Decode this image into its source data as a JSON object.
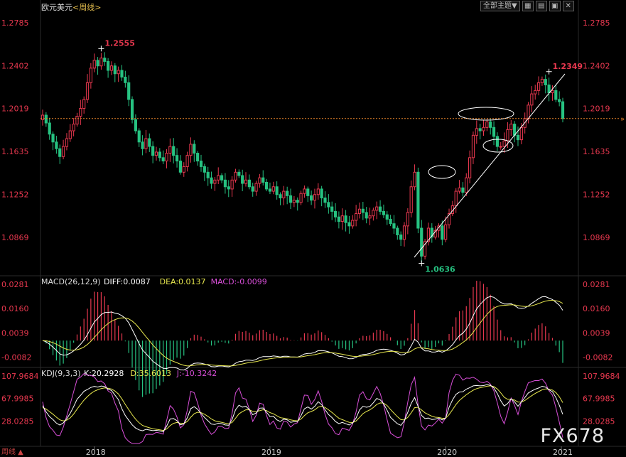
{
  "header": {
    "symbol": "欧元美元",
    "period": "<周线>",
    "menu_label": "全部主题▼",
    "icons": [
      "grid-icon",
      "list-icon",
      "restore-icon",
      "close-icon"
    ]
  },
  "watermark": "FX678",
  "footer_label": "周线 ▲",
  "colors": {
    "up": "#e8384f",
    "down": "#26c281",
    "price_axis": "#e8384f",
    "macd_diff": "#ffffff",
    "macd_dea": "#e8e84f",
    "macd_bar": "#e8384f",
    "kdj_k": "#ffffff",
    "kdj_d": "#e8e84f",
    "kdj_j": "#d94fd9",
    "ref_line": "#e8842a"
  },
  "chart_data": [
    {
      "type": "candlestick",
      "price_axis_ticks": [
        "1.2785",
        "1.2402",
        "1.2019",
        "1.1635",
        "1.1252",
        "1.0869"
      ],
      "ylim": [
        1.055,
        1.29
      ],
      "x_labels": [
        "2018",
        "2019",
        "2020",
        "2021"
      ],
      "annotations": [
        {
          "text": "1.2555",
          "value": 1.2555,
          "date": "2018-02"
        },
        {
          "text": "1.2349",
          "value": 1.2349,
          "date": "2021-01"
        },
        {
          "text": "1.0636",
          "value": 1.0636,
          "date": "2020-03"
        }
      ],
      "current_price": 1.193,
      "weekly_close": [
        1.196,
        1.189,
        1.179,
        1.172,
        1.166,
        1.159,
        1.168,
        1.175,
        1.182,
        1.188,
        1.195,
        1.202,
        1.21,
        1.225,
        1.238,
        1.245,
        1.24,
        1.247,
        1.244,
        1.236,
        1.24,
        1.233,
        1.236,
        1.23,
        1.225,
        1.21,
        1.192,
        1.182,
        1.172,
        1.166,
        1.175,
        1.168,
        1.16,
        1.163,
        1.158,
        1.155,
        1.162,
        1.168,
        1.16,
        1.155,
        1.145,
        1.15,
        1.16,
        1.17,
        1.162,
        1.155,
        1.15,
        1.145,
        1.14,
        1.135,
        1.138,
        1.142,
        1.138,
        1.132,
        1.13,
        1.138,
        1.145,
        1.142,
        1.135,
        1.138,
        1.132,
        1.128,
        1.135,
        1.14,
        1.136,
        1.13,
        1.128,
        1.132,
        1.125,
        1.122,
        1.128,
        1.124,
        1.118,
        1.12,
        1.118,
        1.126,
        1.13,
        1.124,
        1.12,
        1.125,
        1.13,
        1.122,
        1.118,
        1.114,
        1.11,
        1.105,
        1.101,
        1.106,
        1.1,
        1.097,
        1.102,
        1.108,
        1.112,
        1.109,
        1.104,
        1.106,
        1.111,
        1.114,
        1.11,
        1.107,
        1.103,
        1.099,
        1.095,
        1.089,
        1.085,
        1.097,
        1.109,
        1.132,
        1.145,
        1.095,
        1.07,
        1.083,
        1.095,
        1.087,
        1.093,
        1.097,
        1.085,
        1.098,
        1.108,
        1.115,
        1.128,
        1.131,
        1.127,
        1.14,
        1.158,
        1.178,
        1.184,
        1.182,
        1.185,
        1.19,
        1.185,
        1.177,
        1.168,
        1.168,
        1.173,
        1.183,
        1.188,
        1.178,
        1.174,
        1.185,
        1.193,
        1.205,
        1.215,
        1.218,
        1.225,
        1.228,
        1.223,
        1.216,
        1.218,
        1.21,
        1.208,
        1.193
      ]
    },
    {
      "type": "line",
      "title": "MACD(26,12,9)",
      "legend": {
        "diff": "DIFF:0.0087",
        "dea": "DEA:0.0137",
        "macd": "MACD:-0.0099"
      },
      "axis_ticks": [
        "0.0281",
        "0.0160",
        "0.0039",
        "-0.0082"
      ],
      "ylim": [
        -0.012,
        0.031
      ]
    },
    {
      "type": "line",
      "title": "KDJ(9,3,3)",
      "legend": {
        "k": "K:20.2928",
        "d": "D:35.6013",
        "j": "J:-10.3242"
      },
      "axis_ticks": [
        "107.9684",
        "67.9985",
        "28.0285"
      ],
      "ylim": [
        -12,
        118
      ]
    }
  ]
}
